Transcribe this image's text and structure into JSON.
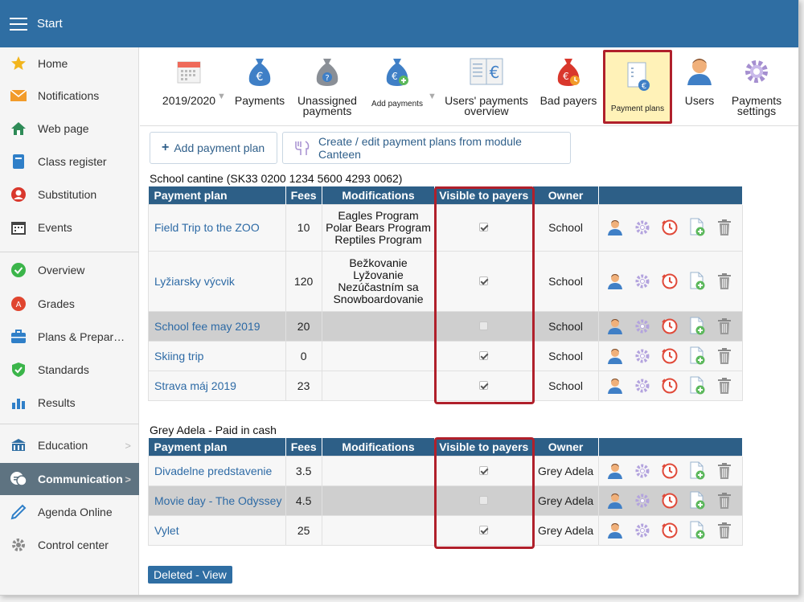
{
  "app": {
    "title": "Start"
  },
  "sidebar": {
    "items": [
      {
        "label": "Home",
        "icon": "star-icon"
      },
      {
        "label": "Notifications",
        "icon": "envelope-icon"
      },
      {
        "label": "Web page",
        "icon": "house-icon"
      },
      {
        "label": "Class register",
        "icon": "book-icon"
      },
      {
        "label": "Substitution",
        "icon": "user-circle-icon"
      },
      {
        "label": "Events",
        "icon": "calendar-icon"
      },
      {
        "label": "Overview",
        "icon": "check-circle-icon"
      },
      {
        "label": "Grades",
        "icon": "grades-icon"
      },
      {
        "label": "Plans & Prepar…",
        "icon": "briefcase-icon"
      },
      {
        "label": "Standards",
        "icon": "shield-check-icon"
      },
      {
        "label": "Results",
        "icon": "bar-chart-icon"
      },
      {
        "label": "Education",
        "icon": "school-icon"
      },
      {
        "label": "Communication",
        "icon": "chat-icon"
      },
      {
        "label": "Agenda Online",
        "icon": "pen-icon"
      },
      {
        "label": "Control center",
        "icon": "gear-icon"
      }
    ]
  },
  "toolbar": {
    "year": "2019/2020",
    "payments": "Payments",
    "unassigned_1": "Unassigned",
    "unassigned_2": "payments",
    "add_payments": "Add payments",
    "users_overview_1": "Users' payments",
    "users_overview_2": "overview",
    "bad_payers": "Bad payers",
    "payment_plans": "Payment plans",
    "users": "Users",
    "settings_1": "Payments",
    "settings_2": "settings"
  },
  "actions": {
    "add_plan": "Add payment plan",
    "create_canteen": "Create / edit payment plans from module Canteen",
    "deleted_view": "Deleted - View"
  },
  "columns": {
    "plan": "Payment plan",
    "fees": "Fees",
    "mods": "Modifications",
    "visible": "Visible to payers",
    "owner": "Owner"
  },
  "section1": {
    "caption": "School cantine (SK33 0200 1234 5600 4293 0062)",
    "rows": [
      {
        "plan": "Field Trip to the ZOO",
        "fees": "10",
        "mods": [
          "Eagles Program",
          "Polar Bears Program",
          "Reptiles Program"
        ],
        "visible": true,
        "owner": "School",
        "grey": false
      },
      {
        "plan": "Lyžiarsky výcvik",
        "fees": "120",
        "mods": [
          "Bežkovanie",
          "Lyžovanie",
          "Nezúčastním sa",
          "Snowboardovanie"
        ],
        "visible": true,
        "owner": "School",
        "grey": false
      },
      {
        "plan": "School fee may 2019",
        "fees": "20",
        "mods": [],
        "visible": false,
        "owner": "School",
        "grey": true
      },
      {
        "plan": "Skiing trip",
        "fees": "0",
        "mods": [],
        "visible": true,
        "owner": "School",
        "grey": false
      },
      {
        "plan": "Strava máj 2019",
        "fees": "23",
        "mods": [],
        "visible": true,
        "owner": "School",
        "grey": false
      }
    ]
  },
  "section2": {
    "caption": "Grey Adela - Paid in cash",
    "rows": [
      {
        "plan": "Divadelne predstavenie",
        "fees": "3.5",
        "mods": [],
        "visible": true,
        "owner": "Grey Adela",
        "grey": false
      },
      {
        "plan": "Movie day - The Odyssey",
        "fees": "4.5",
        "mods": [],
        "visible": false,
        "owner": "Grey Adela",
        "grey": true
      },
      {
        "plan": "Vylet",
        "fees": "25",
        "mods": [],
        "visible": true,
        "owner": "Grey Adela",
        "grey": false
      }
    ]
  },
  "colors": {
    "header": "#2f6ea3",
    "table_header": "#2d5f87",
    "highlight": "#b0202b",
    "selected_tool": "#fff2b8"
  }
}
